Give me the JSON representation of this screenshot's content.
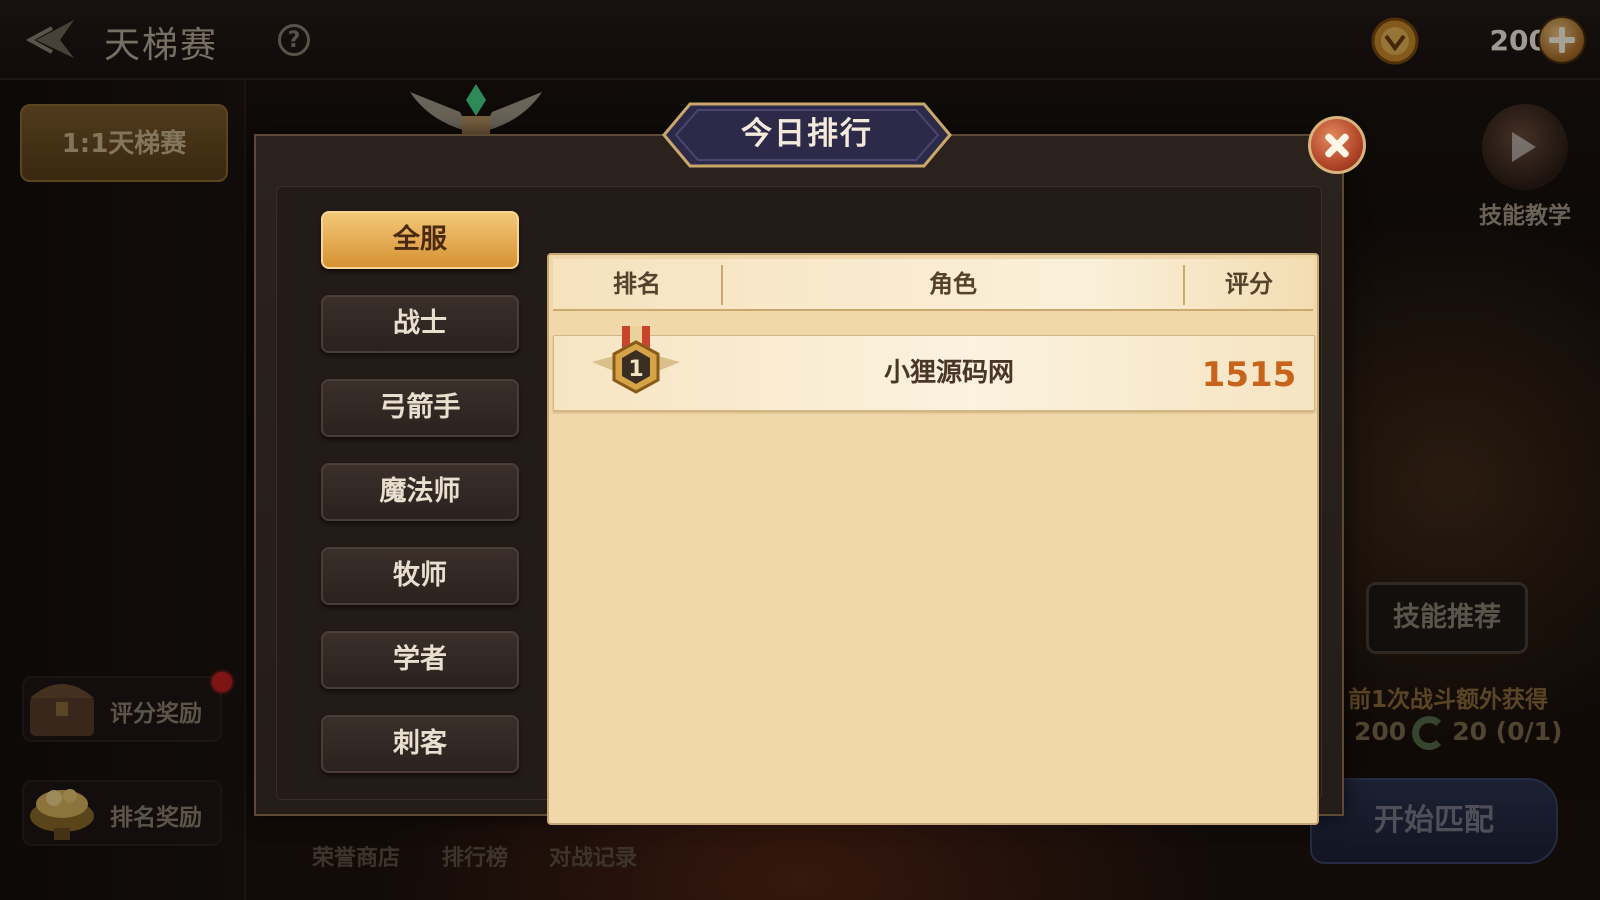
{
  "header": {
    "title": "天梯赛",
    "help_label": "?",
    "currency_value": "200"
  },
  "sidebar": {
    "mode_tab": "1:1天梯赛",
    "score_reward": "评分奖励",
    "rank_reward": "排名奖励"
  },
  "right_panel": {
    "skill_tutorial": "技能教学",
    "skill_recommend": "技能推荐",
    "bonus_text": "前1次战斗额外获得",
    "bonus_amount_left": "200",
    "bonus_amount_right": "20 (0/1)",
    "start_match": "开始匹配"
  },
  "bottom_nav": [
    "荣誉商店",
    "排行榜",
    "对战记录"
  ],
  "modal": {
    "title": "今日排行",
    "categories": [
      "全服",
      "战士",
      "弓箭手",
      "魔法师",
      "牧师",
      "学者",
      "刺客"
    ],
    "active_category": "全服",
    "columns": [
      "排名",
      "角色",
      "评分"
    ],
    "rows": [
      {
        "rank": "1",
        "name": "小狸源码网",
        "score": "1515"
      }
    ]
  },
  "colors": {
    "accent_gold": "#d69233",
    "score_orange": "#c8631c",
    "close_red": "#b2462a"
  }
}
